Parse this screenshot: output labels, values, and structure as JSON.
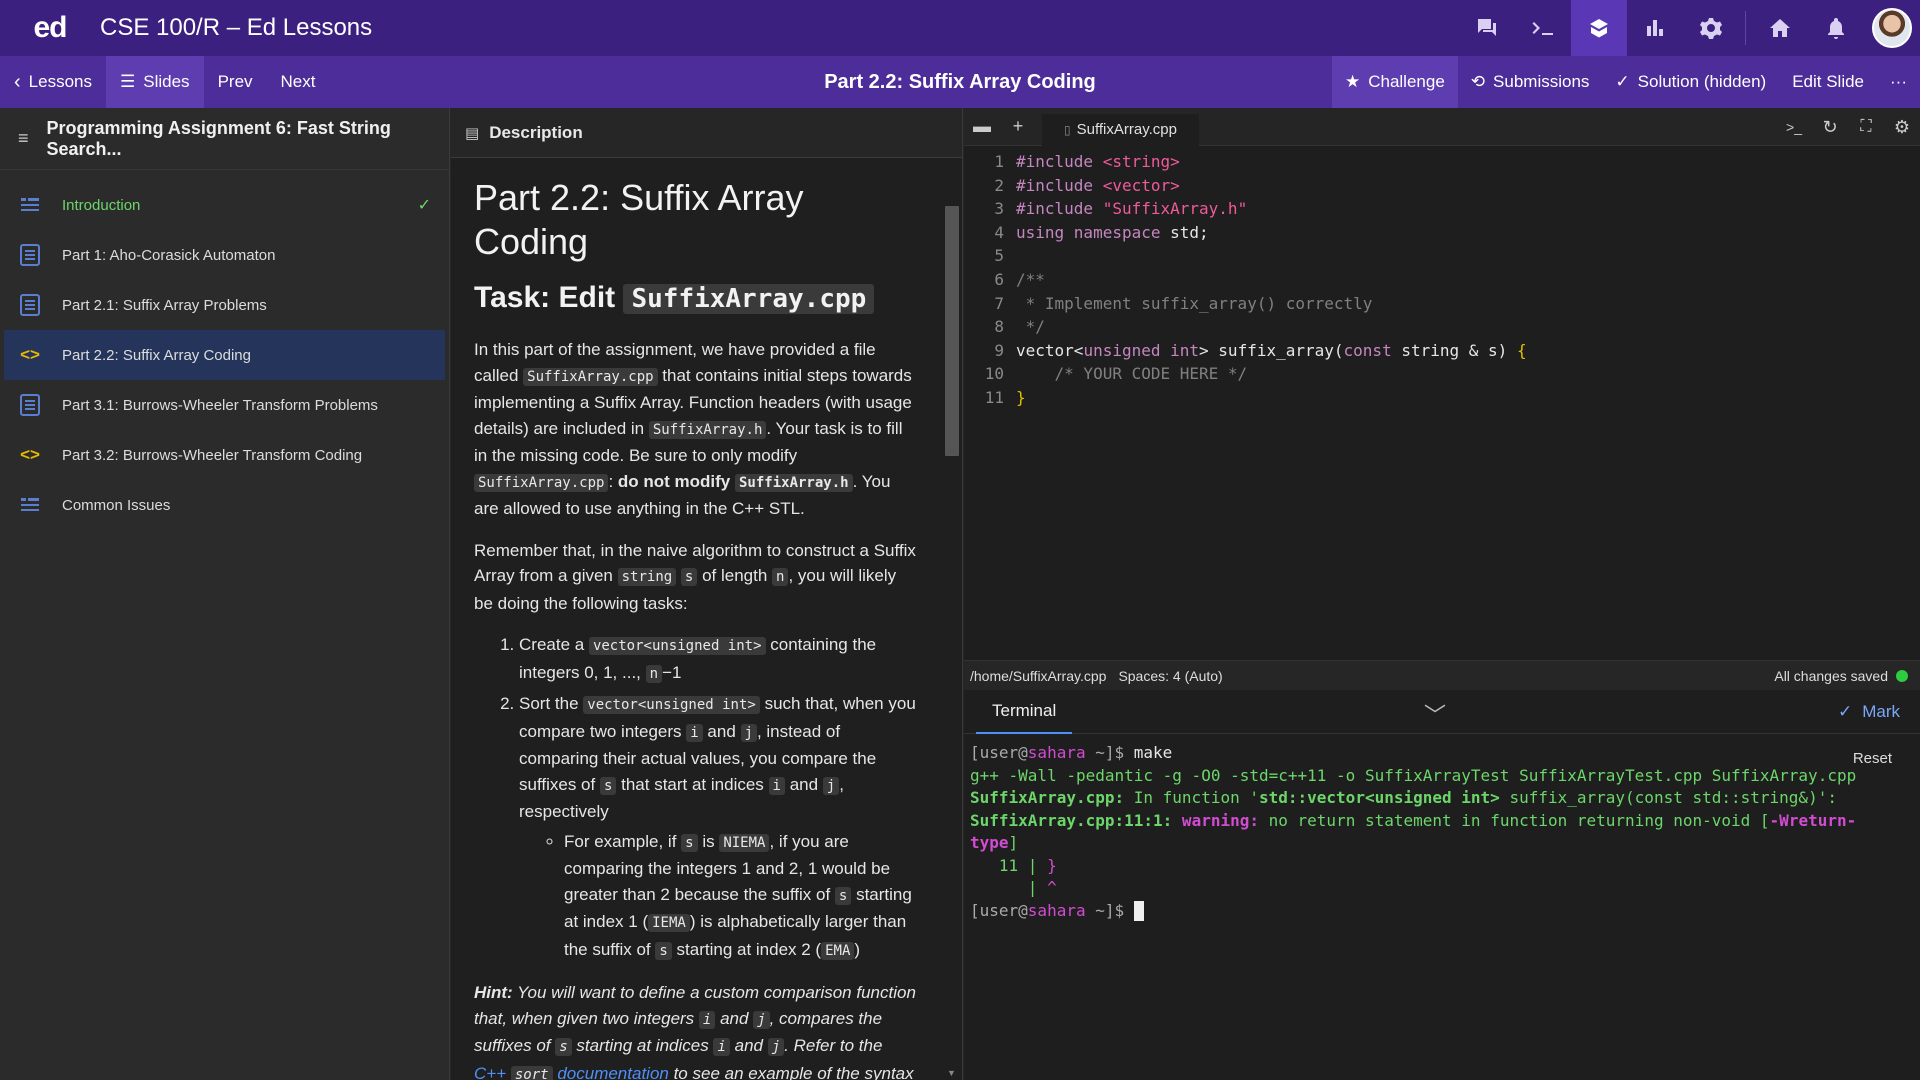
{
  "topbar": {
    "logo": "ed",
    "course_title": "CSE 100/R – Ed Lessons",
    "icons": [
      "chat-icon",
      "terminal-icon",
      "lessons-icon",
      "analytics-icon",
      "settings-icon",
      "home-icon",
      "bell-icon",
      "avatar"
    ]
  },
  "subbar": {
    "lessons_label": "Lessons",
    "slides_label": "Slides",
    "prev_label": "Prev",
    "next_label": "Next",
    "slide_title": "Part 2.2: Suffix Array Coding",
    "challenge_label": "Challenge",
    "submissions_label": "Submissions",
    "solution_label": "Solution (hidden)",
    "edit_label": "Edit Slide",
    "more_label": "···"
  },
  "sidebar": {
    "title": "Programming Assignment 6: Fast String Search...",
    "items": [
      {
        "label": "Introduction",
        "icon": "list-icon",
        "state": "done"
      },
      {
        "label": "Part 1: Aho-Corasick Automaton",
        "icon": "quiz-icon",
        "state": ""
      },
      {
        "label": "Part 2.1: Suffix Array Problems",
        "icon": "quiz-icon",
        "state": ""
      },
      {
        "label": "Part 2.2: Suffix Array Coding",
        "icon": "code-icon",
        "state": "current"
      },
      {
        "label": "Part 3.1: Burrows-Wheeler Transform Problems",
        "icon": "quiz-icon",
        "state": ""
      },
      {
        "label": "Part 3.2: Burrows-Wheeler Transform Coding",
        "icon": "code-icon",
        "state": ""
      },
      {
        "label": "Common Issues",
        "icon": "list-icon",
        "state": ""
      }
    ]
  },
  "description": {
    "header": "Description",
    "h1": "Part 2.2: Suffix Array Coding",
    "h2_prefix": "Task: Edit ",
    "h2_code": "SuffixArray.cpp",
    "p1": {
      "a": "In this part of the assignment, we have provided a file called ",
      "code1": "SuffixArray.cpp",
      "b": " that contains initial steps towards implementing a Suffix Array. Function headers (with usage details) are included in ",
      "code2": "SuffixArray.h",
      "c": ". Your task is to fill in the missing code. Be sure to only modify ",
      "code3": "SuffixArray.cpp",
      "d": ": ",
      "bold": "do not modify",
      "code4": "SuffixArray.h",
      "e": ". You are allowed to use anything in the C++ STL."
    },
    "p2": {
      "a": "Remember that, in the naive algorithm to construct a Suffix Array from a given ",
      "code1": "string",
      "code2": "s",
      "b": " of length ",
      "code3": "n",
      "c": ", you will likely be doing the following tasks:"
    },
    "li1": {
      "a": "Create a ",
      "code1": "vector<unsigned int>",
      "b": " containing the integers 0, 1, ..., ",
      "code2": "n",
      "c": "−1"
    },
    "li2": {
      "a": "Sort the ",
      "code1": "vector<unsigned int>",
      "b": " such that, when you compare two integers ",
      "code2": "i",
      "c": " and ",
      "code3": "j",
      "d": ", instead of comparing their actual values, you compare the suffixes of ",
      "code4": "s",
      "e": " that start at indices ",
      "code5": "i",
      "f": " and ",
      "code6": "j",
      "g": ", respectively"
    },
    "sub": {
      "a": "For example, if ",
      "code1": "s",
      "b": " is ",
      "code2": "NIEMA",
      "c": ", if you are comparing the integers 1 and 2, 1 would be greater than 2 because the suffix of ",
      "code3": "s",
      "d": " starting at index 1 (",
      "code4": "IEMA",
      "e": ") is alphabetically larger than the suffix of ",
      "code5": "s",
      "f": " starting at index 2 (",
      "code6": "EMA",
      "g": ")"
    },
    "hint": {
      "label": "Hint:",
      "a": " You will want to define a custom comparison function that, when given two integers ",
      "code1": "i",
      "b": " and ",
      "code2": "j",
      "c": ", compares the suffixes of ",
      "code3": "s",
      "d": " starting at indices ",
      "code4": "i",
      "e": " and ",
      "code5": "j",
      "f": ". Refer to the ",
      "link1": "C++",
      "code6": "sort",
      "link2": "documentation",
      "g": " to see an example of the syntax of"
    }
  },
  "editor": {
    "filename": "SuffixArray.cpp",
    "lines": [
      "1",
      "2",
      "3",
      "4",
      "5",
      "6",
      "7",
      "8",
      "9",
      "10",
      "11"
    ],
    "status_path": "/home/SuffixArray.cpp",
    "status_spaces": "Spaces: 4 (Auto)",
    "saved_text": "All changes saved",
    "saved_color": "#2ecc40"
  },
  "code": {
    "l1a": "#include ",
    "l1b": "<string>",
    "l2a": "#include ",
    "l2b": "<vector>",
    "l3a": "#include ",
    "l3b": "\"SuffixArray.h\"",
    "l4a": "using namespace",
    "l4b": " std;",
    "l6": "/**",
    "l7": " * Implement suffix_array() correctly",
    "l8": " */",
    "l9a": "vector<",
    "l9b": "unsigned int",
    "l9c": "> suffix_array(",
    "l9d": "const",
    "l9e": " string & s) ",
    "l9f": "{",
    "l10": "    /* YOUR CODE HERE */",
    "l11": "}"
  },
  "terminal": {
    "tab": "Terminal",
    "mark_label": "Mark",
    "reset_label": "Reset",
    "prompt_user": "[user@",
    "prompt_host": "sahara",
    "prompt_rest": " ~]$ ",
    "cmd": "make",
    "line2": "g++ -Wall -pedantic -g -O0 -std=c++11 -o SuffixArrayTest SuffixArrayTest.cpp SuffixArray.cpp",
    "line3a": "SuffixArray.cpp:",
    "line3b": " In function '",
    "line3c": "std::vector<unsigned int>",
    "line3d": " suffix_array(const std::string&)':",
    "line4a": "SuffixArray.cpp:11:1:",
    "line4b": " warning:",
    "line4c": " no return statement in function returning non-void [",
    "line4d": "-Wreturn-",
    "line5a": "type",
    "line5b": "]",
    "line6a": "   11 | ",
    "line6b": "}",
    "line7a": "      | ",
    "line7b": "^"
  }
}
